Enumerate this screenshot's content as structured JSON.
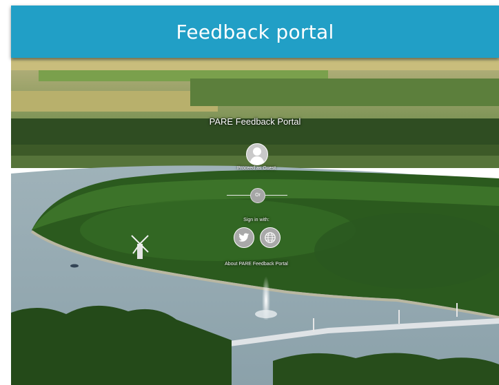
{
  "header": {
    "title": "Feedback portal",
    "background_color": "#219fc6"
  },
  "portal": {
    "title": "PARE Feedback Portal",
    "guest_label": "Proceed as Guest",
    "divider_text": "Or",
    "signin_label": "Sign in with:",
    "about_link": "About PARE Feedback Portal"
  },
  "icons": {
    "guest": "user-avatar-icon",
    "twitter": "twitter-bird-icon",
    "web": "globe-icon"
  }
}
